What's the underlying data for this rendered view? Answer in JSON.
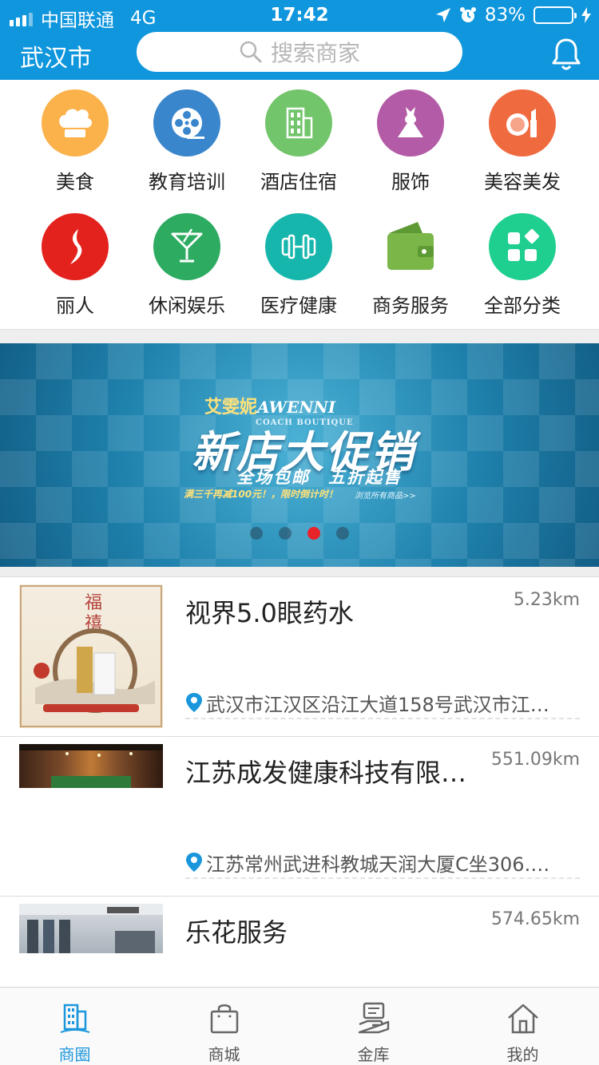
{
  "status_bar": {
    "carrier": "中国联通",
    "network": "4G",
    "time": "17:42",
    "battery": "83%",
    "battery_level": 0.83
  },
  "header": {
    "city": "武汉市",
    "search_placeholder": "搜索商家",
    "background_color": "#0f96dd"
  },
  "categories": [
    {
      "label": "美食",
      "icon": "chef-hat-icon",
      "color": "#fbb24b"
    },
    {
      "label": "教育培训",
      "icon": "film-reel-icon",
      "color": "#3a86cd"
    },
    {
      "label": "酒店住宿",
      "icon": "building-icon",
      "color": "#72c56a"
    },
    {
      "label": "服饰",
      "icon": "dress-icon",
      "color": "#b35ba6"
    },
    {
      "label": "美容美发",
      "icon": "makeup-icon",
      "color": "#f06a3f"
    },
    {
      "label": "丽人",
      "icon": "figure-icon",
      "color": "#e3221e"
    },
    {
      "label": "休闲娱乐",
      "icon": "cocktail-icon",
      "color": "#2cab61"
    },
    {
      "label": "医疗健康",
      "icon": "dumbbell-icon",
      "color": "#17b6ac"
    },
    {
      "label": "商务服务",
      "icon": "wallet-icon",
      "color": "#7ab648"
    },
    {
      "label": "全部分类",
      "icon": "grid-icon",
      "color": "#1fcf8f"
    }
  ],
  "banner": {
    "brand_cn": "艾雯妮",
    "brand_en": "AWENNI",
    "brand_sub": "COACH BOUTIQUE",
    "title": "新店大促销",
    "line2": "全场包邮　五折起售",
    "line3": "满三千再减100元！，限时倒计时！",
    "line3b": "浏览所有商品>>",
    "dots_total": 4,
    "dots_active_index": 2
  },
  "listings": [
    {
      "name": "视界5.0眼药水",
      "distance": "5.23km",
      "address": "武汉市江汉区沿江大道158号武汉市江…",
      "thumb": "poster"
    },
    {
      "name": "江苏成发健康科技有限…",
      "distance": "551.09km",
      "address": "江苏常州武进科教城天润大厦C坐306.…",
      "thumb": "stage"
    },
    {
      "name": "乐花服务",
      "distance": "574.65km",
      "address": "",
      "thumb": "room"
    }
  ],
  "tabs": [
    {
      "label": "商圈",
      "icon": "buildings-icon",
      "active": true
    },
    {
      "label": "商城",
      "icon": "shopping-bag-icon",
      "active": false
    },
    {
      "label": "金库",
      "icon": "vault-icon",
      "active": false
    },
    {
      "label": "我的",
      "icon": "home-icon",
      "active": false
    }
  ],
  "accent_color": "#1a96dc"
}
